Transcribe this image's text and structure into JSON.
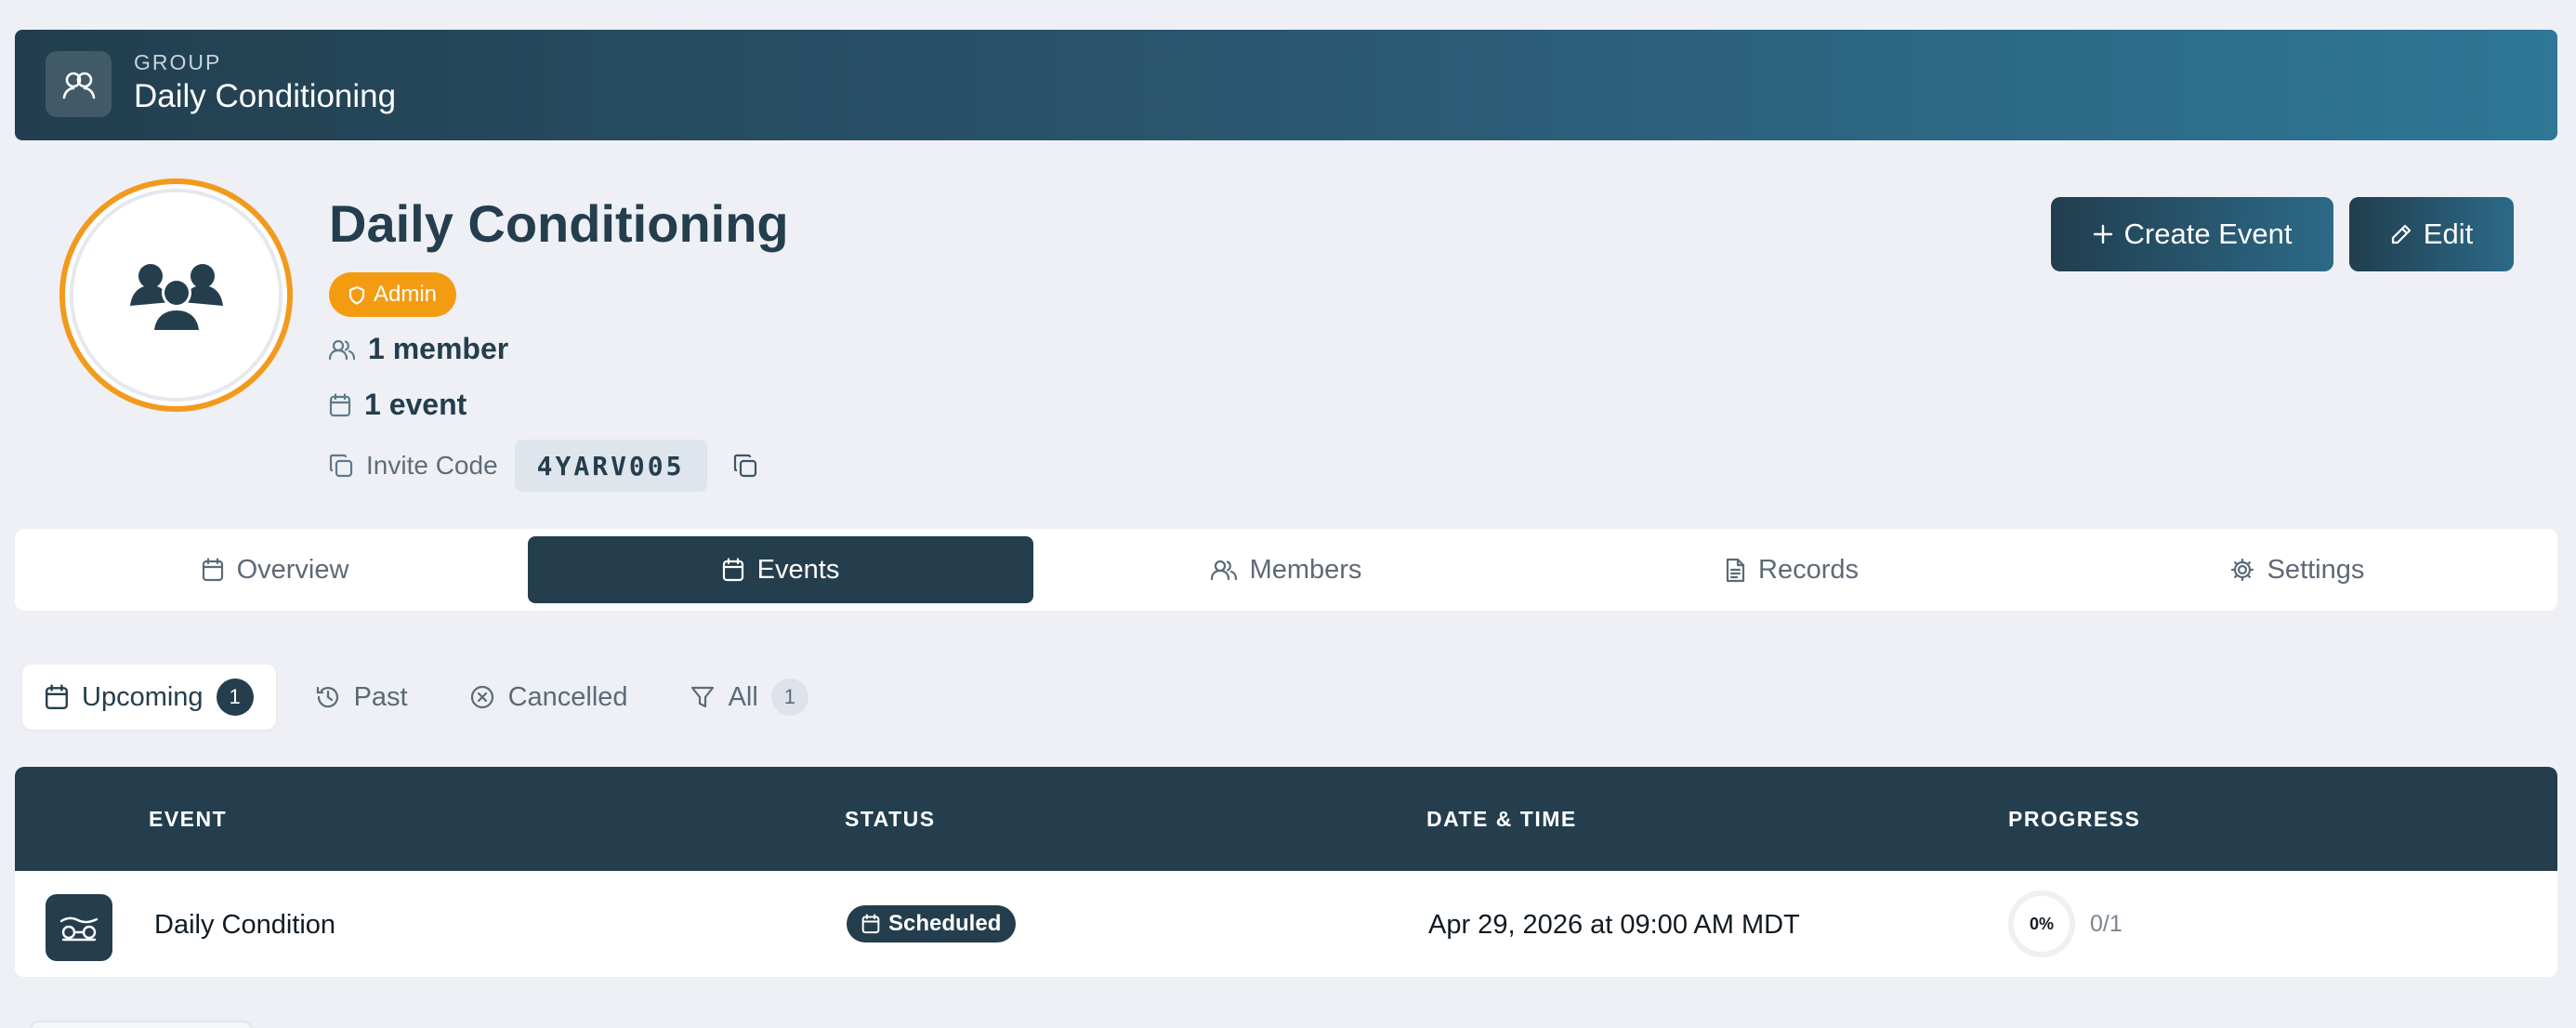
{
  "banner": {
    "kicker": "GROUP",
    "title": "Daily Conditioning",
    "icon": "group-icon"
  },
  "group": {
    "title": "Daily Conditioning",
    "role_badge": "Admin",
    "member_count": "1 member",
    "event_count": "1 event",
    "invite_label": "Invite Code",
    "invite_code": "4YARV005",
    "avatar_icon": "users-icon"
  },
  "actions": {
    "create_event": "Create Event",
    "edit": "Edit"
  },
  "tabs": [
    {
      "label": "Overview",
      "icon": "calendar-icon",
      "active": false
    },
    {
      "label": "Events",
      "icon": "calendar-icon",
      "active": true
    },
    {
      "label": "Members",
      "icon": "users-icon",
      "active": false
    },
    {
      "label": "Records",
      "icon": "document-icon",
      "active": false
    },
    {
      "label": "Settings",
      "icon": "gear-icon",
      "active": false
    }
  ],
  "filters": [
    {
      "label": "Upcoming",
      "count": "1",
      "active": true
    },
    {
      "label": "Past",
      "active": false
    },
    {
      "label": "Cancelled",
      "active": false
    },
    {
      "label": "All",
      "count": "1",
      "active": false
    }
  ],
  "table": {
    "headers": {
      "event": "EVENT",
      "status": "STATUS",
      "datetime": "DATE & TIME",
      "progress": "PROGRESS"
    },
    "rows": [
      {
        "event": "Daily Condition",
        "status": "Scheduled",
        "datetime": "Apr 29, 2026 at 09:00 AM MDT",
        "progress_percent": "0%",
        "progress_count": "0/1"
      }
    ]
  },
  "colors": {
    "primary": "#243e4d",
    "accent": "#f39c12",
    "background": "#eef0f5"
  }
}
